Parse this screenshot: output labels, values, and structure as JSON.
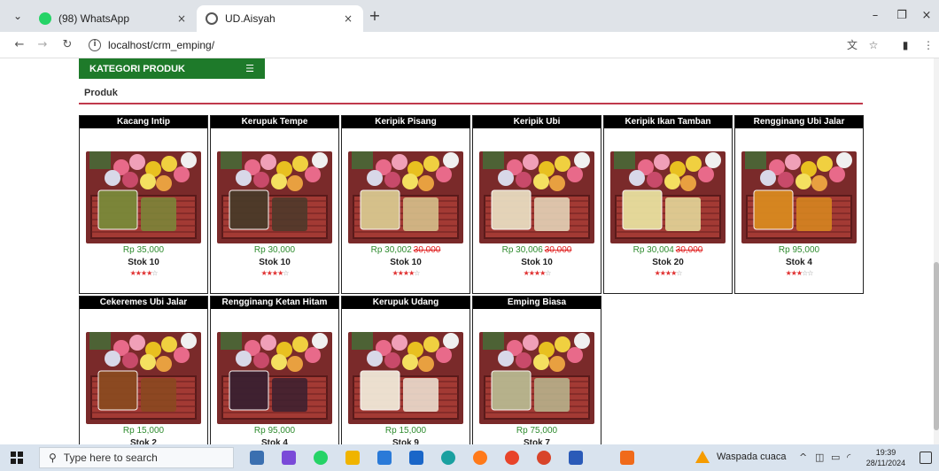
{
  "browser": {
    "tabs": [
      {
        "title": "(98) WhatsApp",
        "close": "×"
      },
      {
        "title": "UD.Aisyah",
        "close": "×"
      }
    ],
    "new_tab": "+",
    "url": "localhost/crm_emping/",
    "window_controls": {
      "minimize": "–",
      "maximize": "❐",
      "close": "×"
    }
  },
  "page": {
    "category_button": "KATEGORI PRODUK",
    "section_title": "Produk"
  },
  "products": [
    {
      "name": "Kacang Intip",
      "price": "Rp 35,000",
      "old_price": "",
      "stock": "Stok 10",
      "rating": 4
    },
    {
      "name": "Kerupuk Tempe",
      "price": "Rp 30,000",
      "old_price": "",
      "stock": "Stok 10",
      "rating": 4
    },
    {
      "name": "Keripik Pisang",
      "price": "Rp 30,002",
      "old_price": "30,000",
      "stock": "Stok 10",
      "rating": 4
    },
    {
      "name": "Keripik Ubi",
      "price": "Rp 30,006",
      "old_price": "30,000",
      "stock": "Stok 10",
      "rating": 4
    },
    {
      "name": "Keripik Ikan Tamban",
      "price": "Rp 30,004",
      "old_price": "30,000",
      "stock": "Stok 20",
      "rating": 4
    },
    {
      "name": "Rengginang Ubi Jalar",
      "price": "Rp 95,000",
      "old_price": "",
      "stock": "Stok 4",
      "rating": 3
    },
    {
      "name": "Cekeremes Ubi Jalar",
      "price": "Rp 15,000",
      "old_price": "",
      "stock": "Stok 2",
      "rating": null
    },
    {
      "name": "Rengginang Ketan Hitam",
      "price": "Rp 95,000",
      "old_price": "",
      "stock": "Stok 4",
      "rating": null
    },
    {
      "name": "Kerupuk Udang",
      "price": "Rp 15,000",
      "old_price": "",
      "stock": "Stok 9",
      "rating": null
    },
    {
      "name": "Emping Biasa",
      "price": "Rp 75,000",
      "old_price": "",
      "stock": "Stok 7",
      "rating": null
    }
  ],
  "product_photo_colors": [
    "#7a8a3a",
    "#4a3a2a",
    "#d8c890",
    "#e8dcc0",
    "#e8e0a0",
    "#d88a20",
    "#8a4a20",
    "#3a2030",
    "#f0e8d8",
    "#b8b890"
  ],
  "taskbar": {
    "search_placeholder": "Type here to search",
    "weather": "Waspada cuaca",
    "time": "19:39",
    "date": "28/11/2024"
  },
  "colors": {
    "category_green": "#1e7a2a",
    "price_green": "#2e8b2e",
    "old_price_red": "#e02020",
    "divider_red": "#c0394b"
  }
}
